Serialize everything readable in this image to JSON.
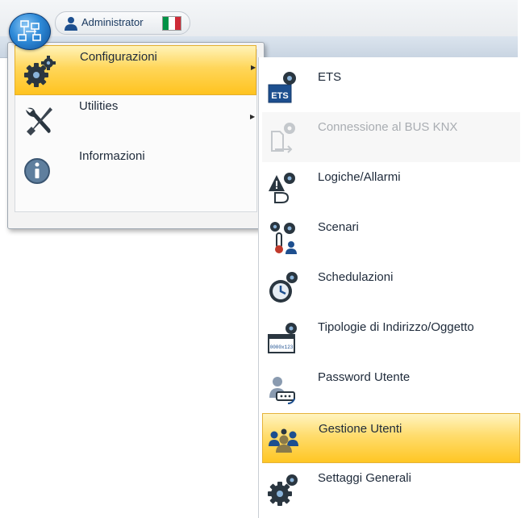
{
  "app": {
    "orb_icon": "network-app-icon",
    "accent": "#2e8ad8"
  },
  "user": {
    "name": "Administrator",
    "icon": "user-icon",
    "flag": "italy-flag-icon",
    "flag_colors": [
      "#009246",
      "#ffffff",
      "#ce2b37"
    ]
  },
  "menu": {
    "items": [
      {
        "label": "Configurazioni",
        "icon": "gears-icon",
        "has_submenu": true,
        "selected": true
      },
      {
        "label": "Utilities",
        "icon": "tools-icon",
        "has_submenu": true,
        "selected": false
      },
      {
        "label": "Informazioni",
        "icon": "info-icon",
        "has_submenu": false,
        "selected": false
      }
    ],
    "selected_color": "#ffd65a"
  },
  "submenu": {
    "items": [
      {
        "label": "ETS",
        "icon": "ets-icon",
        "enabled": true
      },
      {
        "label": "Connessione al BUS KNX",
        "icon": "bus-connection-icon",
        "enabled": false
      },
      {
        "label": "Logiche/Allarmi",
        "icon": "logic-alarm-icon",
        "enabled": true
      },
      {
        "label": "Scenari",
        "icon": "scenarios-icon",
        "enabled": true
      },
      {
        "label": "Schedulazioni",
        "icon": "clock-icon",
        "enabled": true
      },
      {
        "label": "Tipologie di Indirizzo/Oggetto",
        "icon": "address-type-icon",
        "enabled": true
      },
      {
        "label": "Password Utente",
        "icon": "user-password-icon",
        "enabled": true
      },
      {
        "label": "Gestione Utenti",
        "icon": "users-management-icon",
        "enabled": true,
        "selected": true
      },
      {
        "label": "Settaggi Generali",
        "icon": "gear-icon",
        "enabled": true
      }
    ]
  }
}
